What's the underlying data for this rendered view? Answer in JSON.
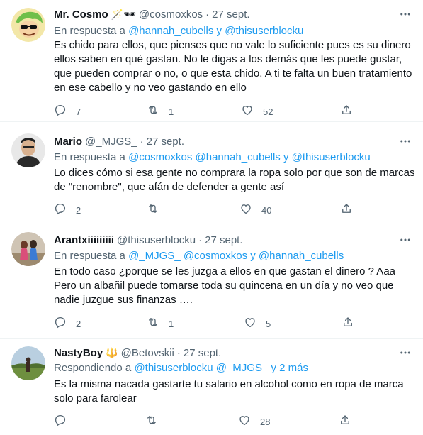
{
  "tweets": [
    {
      "name": "Mr. Cosmo",
      "emoji": "🪄🕶",
      "handle": "@cosmoxkos",
      "dot": "·",
      "date": "27 sept.",
      "reply_prefix": "En respuesta a",
      "reply_mentions": "@hannah_cubells y @thisuserblocku",
      "text": "Es chido para ellos, que pienses que no vale lo suficiente pues es su dinero ellos saben en qué gastan. No le digas a los demás que les puede gustar, que pueden comprar o no, o que esta chido. A ti te falta un buen tratamiento en ese cabello y no veo gastando en ello",
      "replies": "7",
      "retweets": "1",
      "likes": "52"
    },
    {
      "name": "Mario",
      "emoji": "",
      "handle": "@_MJGS_",
      "dot": "·",
      "date": "27 sept.",
      "reply_prefix": "En respuesta a",
      "reply_mentions": "@cosmoxkos @hannah_cubells y @thisuserblocku",
      "text": "Lo dices cómo si esa gente no comprara la ropa solo por que son de marcas de  \"renombre\", que afán de defender a gente así",
      "replies": "2",
      "retweets": "",
      "likes": "40"
    },
    {
      "name": "Arantxiiiiiiiii",
      "emoji": "",
      "handle": "@thisuserblocku",
      "dot": "·",
      "date": "27 sept.",
      "reply_prefix": "En respuesta a",
      "reply_mentions": "@_MJGS_ @cosmoxkos y @hannah_cubells",
      "text": "En todo caso ¿porque se les juzga  a ellos en que gastan el dinero ? Aaa Pero un albañil puede tomarse toda su quincena en un día y no veo que nadie juzgue sus finanzas ….",
      "replies": "2",
      "retweets": "1",
      "likes": "5"
    },
    {
      "name": "NastyBoy",
      "emoji": "🔱",
      "handle": "@Betovskii",
      "dot": "·",
      "date": "27 sept.",
      "reply_prefix": "Respondiendo a",
      "reply_mentions": "@thisuserblocku @_MJGS_ y 2 más",
      "text": "Es la misma nacada gastarte tu salario en alcohol como en ropa de marca solo para farolear",
      "replies": "",
      "retweets": "",
      "likes": "28"
    }
  ],
  "colors": {
    "text": "#0f1419",
    "secondary": "#536471",
    "link": "#1d9bf0",
    "divider": "#eff3f4"
  },
  "icons": [
    "more-icon",
    "reply-icon",
    "retweet-icon",
    "like-icon",
    "share-icon"
  ]
}
